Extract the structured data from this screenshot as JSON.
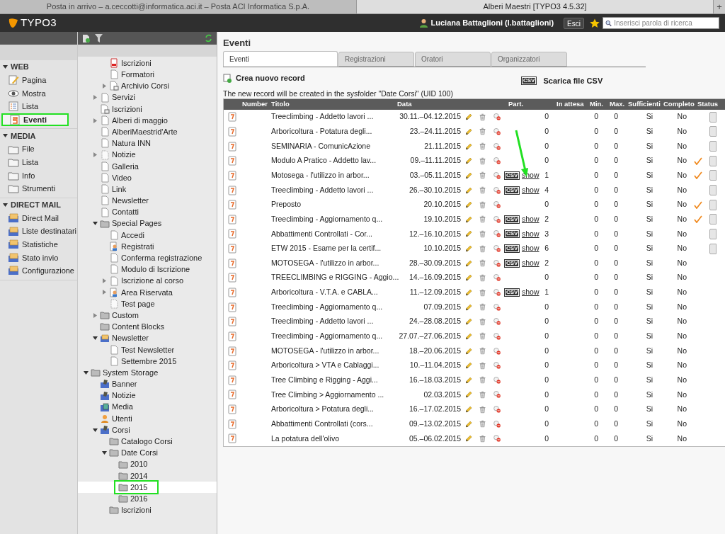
{
  "browser_tabs": [
    {
      "title": "Posta in arrivo – a.ceccotti@informatica.aci.it – Posta ACI Informatica S.p.A.",
      "selected": false
    },
    {
      "title": "Alberi Maestri [TYPO3 4.5.32]",
      "selected": true
    }
  ],
  "new_tab": "+",
  "topbar": {
    "logo": "TYPO3",
    "user": "Luciana Battaglioni (l.battaglioni)",
    "logout": "Esci",
    "search_placeholder": "Inserisci parola di ricerca"
  },
  "modules": [
    {
      "title": "WEB",
      "expanded": true,
      "items": [
        {
          "label": "Pagina",
          "kind": "edit",
          "selected": false
        },
        {
          "label": "Mostra",
          "kind": "eye",
          "selected": false
        },
        {
          "label": "Lista",
          "kind": "list",
          "selected": false
        },
        {
          "label": "Eventi",
          "kind": "calendar",
          "selected": true,
          "highlighted": true
        }
      ]
    },
    {
      "title": "MEDIA",
      "expanded": true,
      "items": [
        {
          "label": "File",
          "kind": "folder",
          "selected": false
        },
        {
          "label": "Lista",
          "kind": "folder",
          "selected": false
        },
        {
          "label": "Info",
          "kind": "folder",
          "selected": false
        },
        {
          "label": "Strumenti",
          "kind": "folder",
          "selected": false
        }
      ]
    },
    {
      "title": "DIRECT MAIL",
      "expanded": true,
      "items": [
        {
          "label": "Direct Mail",
          "kind": "mail",
          "selected": false
        },
        {
          "label": "Liste destinatari",
          "kind": "mail",
          "selected": false
        },
        {
          "label": "Statistiche",
          "kind": "mail",
          "selected": false
        },
        {
          "label": "Stato invio",
          "kind": "mail",
          "selected": false
        },
        {
          "label": "Configurazione",
          "kind": "mail",
          "selected": false
        }
      ]
    }
  ],
  "tree": {
    "scrolled_branch": [
      {
        "label": "Iscrizioni",
        "kind": "form",
        "selected": false
      },
      {
        "label": "Formatori",
        "kind": "page",
        "selected": false
      },
      {
        "label": "Archivio Corsi",
        "kind": "shortcut",
        "selected": false,
        "expanded": false
      }
    ],
    "scrolled_siblings": [
      {
        "label": "Servizi",
        "kind": "page",
        "selected": false,
        "expanded": false
      },
      {
        "label": "Iscrizioni",
        "kind": "shortcut",
        "selected": false
      },
      {
        "label": "Alberi di maggio",
        "kind": "page",
        "selected": false,
        "expanded": false
      },
      {
        "label": "AlberiMaestrid'Arte",
        "kind": "page",
        "selected": false
      },
      {
        "label": "Natura INN",
        "kind": "page",
        "selected": false
      },
      {
        "label": "Notizie",
        "kind": "hidden",
        "selected": false,
        "expanded": false
      },
      {
        "label": "Galleria",
        "kind": "page",
        "selected": false
      },
      {
        "label": "Video",
        "kind": "page",
        "selected": false
      },
      {
        "label": "Link",
        "kind": "page",
        "selected": false
      },
      {
        "label": "Newsletter",
        "kind": "page",
        "selected": false
      },
      {
        "label": "Contatti",
        "kind": "page",
        "selected": false
      },
      {
        "label": "Special Pages",
        "kind": "folder",
        "selected": false,
        "expanded": true,
        "children": [
          {
            "label": "Accedi",
            "kind": "page",
            "selected": false
          },
          {
            "label": "Registrati",
            "kind": "user",
            "selected": false
          },
          {
            "label": "Conferma registrazione",
            "kind": "page",
            "selected": false
          },
          {
            "label": "Modulo di Iscrizione",
            "kind": "page",
            "selected": false
          },
          {
            "label": "Iscrizione al corso",
            "kind": "page",
            "selected": false,
            "expanded": false
          },
          {
            "label": "Area Riservata",
            "kind": "user",
            "selected": false,
            "expanded": false
          },
          {
            "label": "Test page",
            "kind": "hidden",
            "selected": false
          }
        ]
      },
      {
        "label": "Custom",
        "kind": "folder",
        "selected": false,
        "expanded": false
      },
      {
        "label": "Content Blocks",
        "kind": "folder",
        "selected": false
      },
      {
        "label": "Newsletter",
        "kind": "mail",
        "selected": false,
        "expanded": true,
        "children": [
          {
            "label": "Test Newsletter",
            "kind": "page",
            "selected": false
          },
          {
            "label": "Settembre 2015",
            "kind": "page",
            "selected": false
          }
        ]
      }
    ],
    "roots": [
      {
        "label": "System Storage",
        "kind": "folder",
        "selected": false,
        "expanded": true,
        "children": [
          {
            "label": "Banner",
            "kind": "plugin",
            "selected": false
          },
          {
            "label": "Notizie",
            "kind": "plugin",
            "selected": false
          },
          {
            "label": "Media",
            "kind": "media",
            "selected": false
          },
          {
            "label": "Utenti",
            "kind": "person",
            "selected": false
          },
          {
            "label": "Corsi",
            "kind": "plugin",
            "selected": false,
            "expanded": true,
            "children": [
              {
                "label": "Catalogo Corsi",
                "kind": "folder",
                "selected": false
              },
              {
                "label": "Date Corsi",
                "kind": "folder",
                "selected": false,
                "expanded": true,
                "children": [
                  {
                    "label": "2010",
                    "kind": "folder",
                    "selected": false
                  },
                  {
                    "label": "2014",
                    "kind": "folder",
                    "selected": false
                  },
                  {
                    "label": "2015",
                    "kind": "folder",
                    "selected": true,
                    "highlighted": true
                  },
                  {
                    "label": "2016",
                    "kind": "folder",
                    "selected": false
                  }
                ]
              },
              {
                "label": "Iscrizioni",
                "kind": "folder",
                "selected": false
              }
            ]
          }
        ]
      }
    ]
  },
  "content": {
    "title": "Eventi",
    "tabs": [
      {
        "label": "Eventi",
        "selected": true
      },
      {
        "label": "Registrazioni",
        "selected": false
      },
      {
        "label": "Oratori",
        "selected": false
      },
      {
        "label": "Organizzatori",
        "selected": false
      }
    ],
    "new_record": "Crea nuovo record",
    "download_csv": {
      "badge": "CSV",
      "label": "Scarica file CSV"
    },
    "info": "The new record will be created in the sysfolder \"Date Corsi\" (UID 100)",
    "columns": [
      "Number",
      "Titolo",
      "Data",
      "Part.",
      "In attesa",
      "Min.",
      "Max.",
      "Sufficienti",
      "Completo",
      "Status"
    ],
    "rows": [
      {
        "title": "Treeclimbing - Addetto lavori ...",
        "date": "30.11.–04.12.2015",
        "part": "0",
        "min": "0",
        "max": "0",
        "sufficienti": "Si",
        "completo": "No",
        "status_ok": false,
        "action_button": true
      },
      {
        "title": "Arboricoltura - Potatura degli...",
        "date": "23.–24.11.2015",
        "part": "0",
        "min": "0",
        "max": "0",
        "sufficienti": "Si",
        "completo": "No",
        "status_ok": false,
        "action_button": true
      },
      {
        "title": "SEMINARIA - ComunicAzione",
        "date": "21.11.2015",
        "part": "0",
        "min": "0",
        "max": "0",
        "sufficienti": "Si",
        "completo": "No",
        "status_ok": false,
        "action_button": true
      },
      {
        "title": "Modulo A Pratico - Addetto lav...",
        "date": "09.–11.11.2015",
        "part": "0",
        "min": "0",
        "max": "0",
        "sufficienti": "Si",
        "completo": "No",
        "status_ok": true,
        "action_button": true
      },
      {
        "title": "Motosega - l'utilizzo in arbor...",
        "date": "03.–05.11.2015",
        "csv": "CSV",
        "show": "show",
        "part": "1",
        "min": "0",
        "max": "0",
        "sufficienti": "Si",
        "completo": "No",
        "status_ok": true,
        "action_button": true
      },
      {
        "title": "Treeclimbing - Addetto lavori ...",
        "date": "26.–30.10.2015",
        "csv": "CSV",
        "show": "show",
        "part": "4",
        "min": "0",
        "max": "0",
        "sufficienti": "Si",
        "completo": "No",
        "status_ok": false,
        "action_button": true
      },
      {
        "title": "Preposto",
        "date": "20.10.2015",
        "part": "0",
        "min": "0",
        "max": "0",
        "sufficienti": "Si",
        "completo": "No",
        "status_ok": true,
        "action_button": true
      },
      {
        "title": "Treeclimbing - Aggiornamento q...",
        "date": "19.10.2015",
        "csv": "CSV",
        "show": "show",
        "part": "2",
        "min": "0",
        "max": "0",
        "sufficienti": "Si",
        "completo": "No",
        "status_ok": true,
        "action_button": true
      },
      {
        "title": "Abbattimenti Controllati - Cor...",
        "date": "12.–16.10.2015",
        "csv": "CSV",
        "show": "show",
        "part": "3",
        "min": "0",
        "max": "0",
        "sufficienti": "Si",
        "completo": "No",
        "status_ok": false,
        "action_button": true
      },
      {
        "title": "ETW 2015 - Esame per la certif...",
        "date": "10.10.2015",
        "csv": "CSV",
        "show": "show",
        "part": "6",
        "min": "0",
        "max": "0",
        "sufficienti": "Si",
        "completo": "No",
        "status_ok": false,
        "action_button": true
      },
      {
        "title": "MOTOSEGA - l'utilizzo in arbor...",
        "date": "28.–30.09.2015",
        "csv": "CSV",
        "show": "show",
        "part": "2",
        "min": "0",
        "max": "0",
        "sufficienti": "Si",
        "completo": "No",
        "status_ok": false,
        "action_button": false
      },
      {
        "title": "TREECLIMBING e RIGGING - Aggio...",
        "date": "14.–16.09.2015",
        "part": "0",
        "min": "0",
        "max": "0",
        "sufficienti": "Si",
        "completo": "No",
        "status_ok": false,
        "action_button": false
      },
      {
        "title": "Arboricoltura - V.T.A. e CABLA...",
        "date": "11.–12.09.2015",
        "csv": "CSV",
        "show": "show",
        "part": "1",
        "min": "0",
        "max": "0",
        "sufficienti": "Si",
        "completo": "No",
        "status_ok": false,
        "action_button": false
      },
      {
        "title": "Treeclimbing - Aggiornamento q...",
        "date": "07.09.2015",
        "part": "0",
        "min": "0",
        "max": "0",
        "sufficienti": "Si",
        "completo": "No",
        "status_ok": false,
        "action_button": false
      },
      {
        "title": "Treeclimbing - Addetto lavori ...",
        "date": "24.–28.08.2015",
        "part": "0",
        "min": "0",
        "max": "0",
        "sufficienti": "Si",
        "completo": "No",
        "status_ok": false,
        "action_button": false
      },
      {
        "title": "Treeclimbing - Aggiornamento q...",
        "date": "27.07.–27.06.2015",
        "part": "0",
        "min": "0",
        "max": "0",
        "sufficienti": "Si",
        "completo": "No",
        "status_ok": false,
        "action_button": false
      },
      {
        "title": "MOTOSEGA - l'utilizzo in arbor...",
        "date": "18.–20.06.2015",
        "part": "0",
        "min": "0",
        "max": "0",
        "sufficienti": "Si",
        "completo": "No",
        "status_ok": false,
        "action_button": false
      },
      {
        "title": "Arboricoltura > VTA e Cablaggi...",
        "date": "10.–11.04.2015",
        "part": "0",
        "min": "0",
        "max": "0",
        "sufficienti": "Si",
        "completo": "No",
        "status_ok": false,
        "action_button": false
      },
      {
        "title": "Tree Climbing e Rigging - Aggi...",
        "date": "16.–18.03.2015",
        "part": "0",
        "min": "0",
        "max": "0",
        "sufficienti": "Si",
        "completo": "No",
        "status_ok": false,
        "action_button": false
      },
      {
        "title": "Tree Climbing > Aggiornamento ...",
        "date": "02.03.2015",
        "part": "0",
        "min": "0",
        "max": "0",
        "sufficienti": "Si",
        "completo": "No",
        "status_ok": false,
        "action_button": false
      },
      {
        "title": "Arboricoltura > Potatura degli...",
        "date": "16.–17.02.2015",
        "part": "0",
        "min": "0",
        "max": "0",
        "sufficienti": "Si",
        "completo": "No",
        "status_ok": false,
        "action_button": false
      },
      {
        "title": "Abbattimenti Controllati (cors...",
        "date": "09.–13.02.2015",
        "part": "0",
        "min": "0",
        "max": "0",
        "sufficienti": "Si",
        "completo": "No",
        "status_ok": false,
        "action_button": false
      },
      {
        "title": "La potatura dell'olivo",
        "date": "05.–06.02.2015",
        "part": "0",
        "min": "0",
        "max": "0",
        "sufficienti": "Si",
        "completo": "No",
        "status_ok": false,
        "action_button": false
      }
    ]
  }
}
